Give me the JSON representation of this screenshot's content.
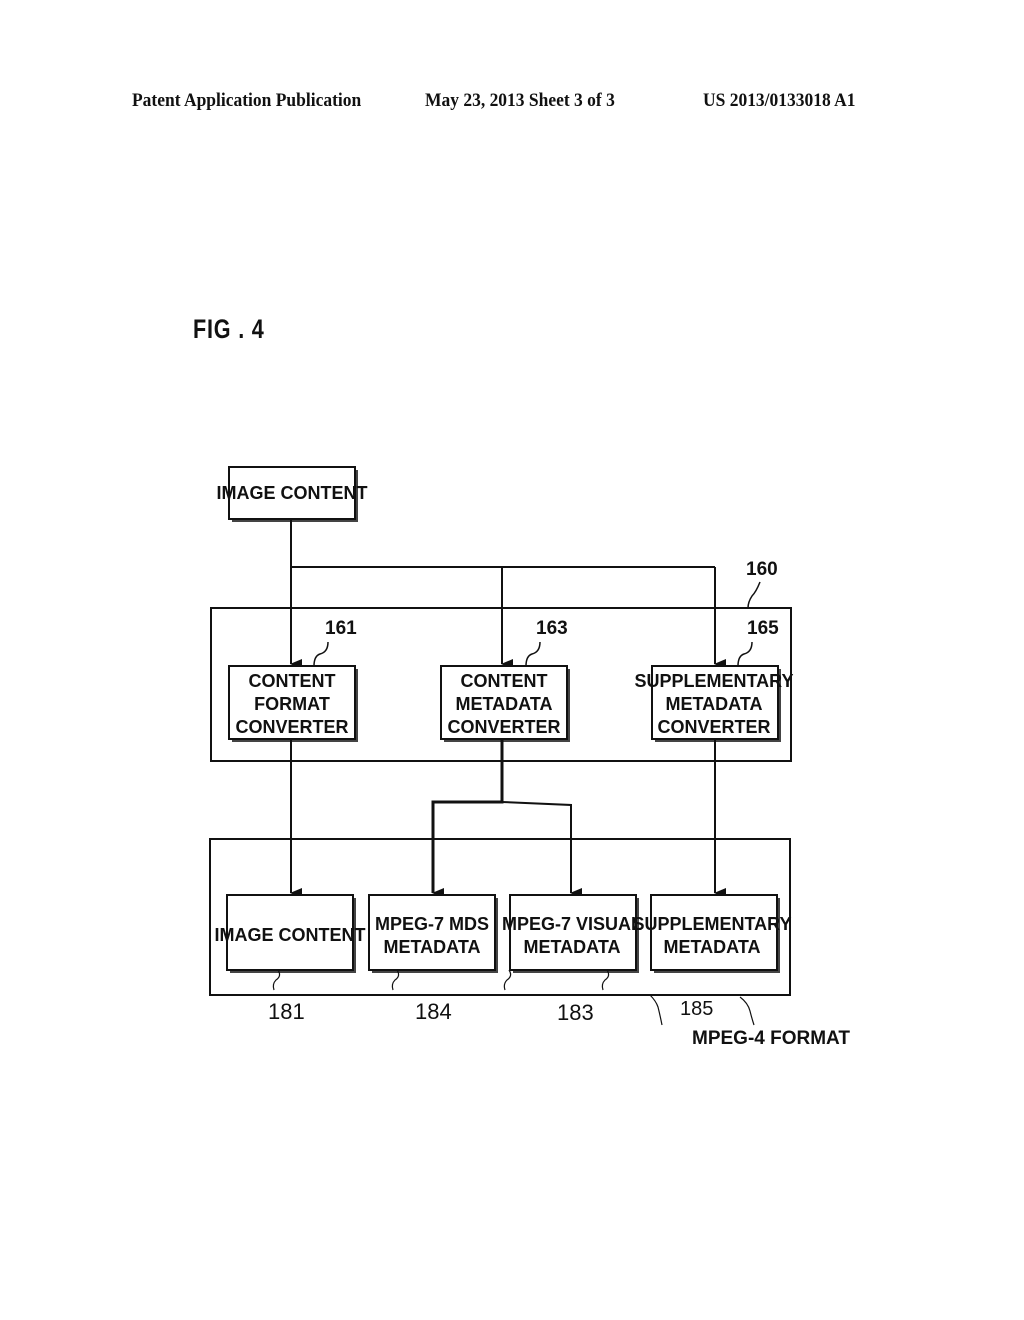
{
  "header": {
    "publication": "Patent Application Publication",
    "date_sheet": "May 23, 2013   Sheet 3 of 3",
    "patent_number": "US 2013/0133018 A1"
  },
  "figure": {
    "label": "FIG . 4",
    "source_box": {
      "text": "IMAGE CONTENT"
    },
    "converter_group": {
      "ref": "160",
      "blocks": [
        {
          "ref": "161",
          "lines": [
            "CONTENT",
            "FORMAT",
            "CONVERTER"
          ]
        },
        {
          "ref": "163",
          "lines": [
            "CONTENT",
            "METADATA",
            "CONVERTER"
          ]
        },
        {
          "ref": "165",
          "lines": [
            "SUPPLEMENTARY",
            "METADATA",
            "CONVERTER"
          ]
        }
      ]
    },
    "output_group": {
      "label": "MPEG-4 FORMAT",
      "blocks": [
        {
          "ref": "181",
          "lines": [
            "IMAGE CONTENT"
          ]
        },
        {
          "ref": "184",
          "lines": [
            "MPEG-7 MDS",
            "METADATA"
          ]
        },
        {
          "ref": "183",
          "lines": [
            "MPEG-7 VISUAL",
            "METADATA"
          ]
        },
        {
          "ref": "185",
          "lines": [
            "SUPPLEMENTARY",
            "METADATA"
          ]
        }
      ]
    }
  }
}
